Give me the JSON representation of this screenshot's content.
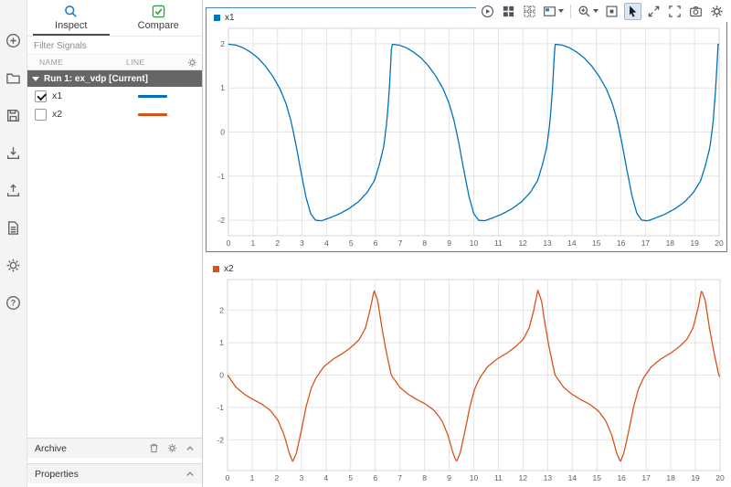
{
  "colors": {
    "accent_blue": "#0072BD",
    "accent_orange": "#D95319",
    "selection_border": "#4585c7"
  },
  "left_toolbar": {
    "icons": [
      "add-icon",
      "open-folder-icon",
      "save-icon",
      "import-icon",
      "export-icon",
      "report-icon",
      "preferences-icon",
      "help-icon"
    ]
  },
  "sidebar": {
    "tabs": [
      {
        "label": "Inspect",
        "selected": true,
        "icon": "search-icon"
      },
      {
        "label": "Compare",
        "selected": false,
        "icon": "green-check-icon"
      }
    ],
    "filter_placeholder": "Filter Signals",
    "table": {
      "columns": [
        "NAME",
        "LINE"
      ],
      "header_icon": "gear-icon"
    },
    "runs": [
      {
        "label": "Run 1: ex_vdp [Current]",
        "expanded": true,
        "signals": [
          {
            "name": "x1",
            "checked": true,
            "color": "#0072BD"
          },
          {
            "name": "x2",
            "checked": false,
            "color": "#D95319"
          }
        ]
      }
    ],
    "archive_label": "Archive",
    "properties_label": "Properties"
  },
  "plot_toolbar": {
    "icons": [
      "run-icon",
      "layout-grid-icon",
      "layout-edit-icon",
      "display-options-icon",
      "zoom-icon",
      "fit-to-view-icon",
      "cursor-icon",
      "expand-arrows-icon",
      "fullscreen-icon",
      "snapshot-camera-icon",
      "settings-gear-icon"
    ],
    "active_tool": "cursor"
  },
  "chart_data": [
    {
      "type": "line",
      "selected": true,
      "xlim": [
        0,
        20
      ],
      "ylim": [
        -2.35,
        2.35
      ],
      "xticks": [
        0,
        1,
        2,
        3,
        4,
        5,
        6,
        7,
        8,
        9,
        10,
        11,
        12,
        13,
        14,
        15,
        16,
        17,
        18,
        19,
        20
      ],
      "yticks": [
        -2,
        -1,
        0,
        1,
        2
      ],
      "grid": true,
      "legend_position": "top-left",
      "series": [
        {
          "name": "x1",
          "color": "#0072BD",
          "periodic": true,
          "period": 6.65,
          "t_end": 20,
          "period_t": [
            0,
            0.3,
            0.6,
            0.9,
            1.2,
            1.5,
            1.8,
            2.1,
            2.35,
            2.55,
            2.75,
            2.95,
            3.15,
            3.35,
            3.55,
            3.8,
            4.1,
            4.5,
            4.9,
            5.3,
            5.65,
            5.95,
            6.15,
            6.33,
            6.45,
            6.55,
            6.62,
            6.65
          ],
          "period_v": [
            1.99,
            1.97,
            1.91,
            1.81,
            1.68,
            1.5,
            1.27,
            0.98,
            0.64,
            0.25,
            -0.28,
            -0.88,
            -1.45,
            -1.85,
            -2.0,
            -2.01,
            -1.95,
            -1.86,
            -1.74,
            -1.58,
            -1.37,
            -1.1,
            -0.74,
            -0.33,
            0.2,
            0.9,
            1.6,
            1.99
          ]
        }
      ]
    },
    {
      "type": "line",
      "selected": false,
      "xlim": [
        0,
        20
      ],
      "ylim": [
        -2.95,
        2.95
      ],
      "xticks": [
        0,
        1,
        2,
        3,
        4,
        5,
        6,
        7,
        8,
        9,
        10,
        11,
        12,
        13,
        14,
        15,
        16,
        17,
        18,
        19,
        20
      ],
      "yticks": [
        -2,
        -1,
        0,
        1,
        2
      ],
      "grid": true,
      "legend_position": "top-left",
      "series": [
        {
          "name": "x2",
          "color": "#D95319",
          "periodic": true,
          "period": 6.65,
          "t_end": 20,
          "period_t": [
            0,
            0.35,
            0.7,
            1.05,
            1.4,
            1.75,
            2.05,
            2.3,
            2.5,
            2.65,
            2.8,
            3.0,
            3.2,
            3.4,
            3.6,
            3.9,
            4.3,
            4.7,
            5.05,
            5.35,
            5.6,
            5.8,
            5.95,
            6.1,
            6.25,
            6.4,
            6.55,
            6.65
          ],
          "period_v": [
            0,
            -0.38,
            -0.6,
            -0.76,
            -0.9,
            -1.1,
            -1.4,
            -1.85,
            -2.4,
            -2.68,
            -2.4,
            -1.7,
            -0.95,
            -0.4,
            -0.08,
            0.25,
            0.5,
            0.68,
            0.88,
            1.1,
            1.45,
            2.05,
            2.62,
            2.3,
            1.55,
            0.9,
            0.35,
            0
          ]
        }
      ]
    }
  ]
}
